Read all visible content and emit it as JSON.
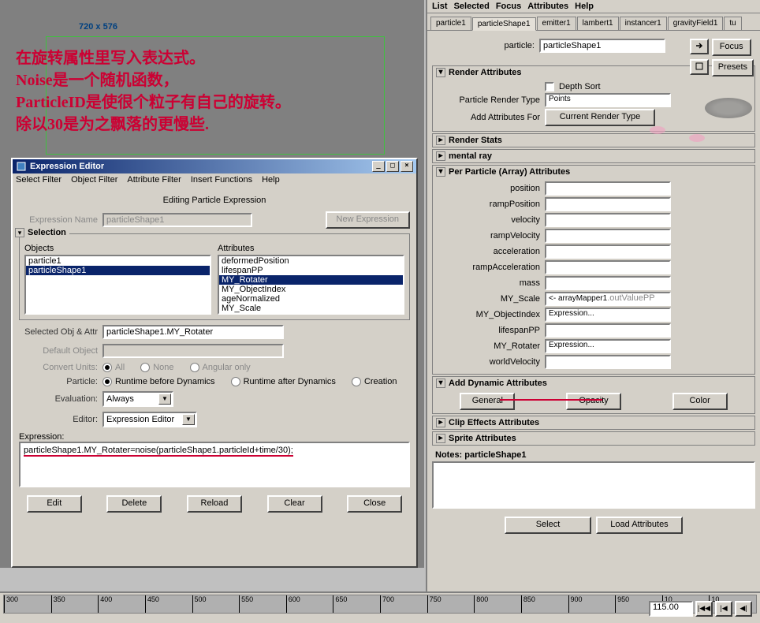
{
  "viewport": {
    "resolution": "720 x 576",
    "annotation": "在旋转属性里写入表达式。\nNoise是一个随机函数，\nParticleID是使很个粒子有自己的旋转。\n除以30是为之飘落的更慢些."
  },
  "expr_editor": {
    "title": "Expression Editor",
    "menu": [
      "Select Filter",
      "Object Filter",
      "Attribute Filter",
      "Insert Functions",
      "Help"
    ],
    "subtitle": "Editing Particle Expression",
    "expr_name_label": "Expression Name",
    "expr_name_value": "particleShape1",
    "new_expr_btn": "New Expression",
    "selection_legend": "Selection",
    "objects_label": "Objects",
    "attributes_label": "Attributes",
    "objects": [
      "particle1",
      "particleShape1"
    ],
    "attributes": [
      "deformedPosition",
      "lifespanPP",
      "MY_Rotater",
      "MY_ObjectIndex",
      "ageNormalized",
      "MY_Scale"
    ],
    "selected_obj_label": "Selected Obj & Attr",
    "selected_obj_value": "particleShape1.MY_Rotater",
    "default_obj_label": "Default Object",
    "convert_units_label": "Convert Units:",
    "convert_units_options": [
      "All",
      "None",
      "Angular only"
    ],
    "particle_label": "Particle:",
    "particle_options": [
      "Runtime before Dynamics",
      "Runtime after Dynamics",
      "Creation"
    ],
    "evaluation_label": "Evaluation:",
    "evaluation_value": "Always",
    "editor_label": "Editor:",
    "editor_value": "Expression Editor",
    "expression_label": "Expression:",
    "expression_text": "particleShape1.MY_Rotater=noise(particleShape1.particleId+time/30);",
    "buttons": [
      "Edit",
      "Delete",
      "Reload",
      "Clear",
      "Close"
    ]
  },
  "attr_editor": {
    "menu": [
      "List",
      "Selected",
      "Focus",
      "Attributes",
      "Help"
    ],
    "tabs": [
      "particle1",
      "particleShape1",
      "emitter1",
      "lambert1",
      "instancer1",
      "gravityField1",
      "tu"
    ],
    "active_tab": "particleShape1",
    "particle_label": "particle:",
    "particle_value": "particleShape1",
    "focus_btn": "Focus",
    "presets_btn": "Presets",
    "sections": {
      "render_attrs": {
        "title": "Render Attributes",
        "depth_sort_label": "Depth Sort",
        "render_type_label": "Particle Render Type",
        "render_type_value": "Points",
        "add_attrs_label": "Add Attributes For",
        "add_attrs_btn": "Current Render Type"
      },
      "render_stats": "Render Stats",
      "mental_ray": "mental ray",
      "per_particle": {
        "title": "Per Particle (Array) Attributes",
        "attrs": [
          {
            "label": "position",
            "value": ""
          },
          {
            "label": "rampPosition",
            "value": ""
          },
          {
            "label": "velocity",
            "value": ""
          },
          {
            "label": "rampVelocity",
            "value": ""
          },
          {
            "label": "acceleration",
            "value": ""
          },
          {
            "label": "rampAcceleration",
            "value": ""
          },
          {
            "label": "mass",
            "value": ""
          },
          {
            "label": "MY_Scale",
            "value": "<- arrayMapper1.outValuePP"
          },
          {
            "label": "MY_ObjectIndex",
            "value": "Expression..."
          },
          {
            "label": "lifespanPP",
            "value": ""
          },
          {
            "label": "MY_Rotater",
            "value": "Expression..."
          },
          {
            "label": "worldVelocity",
            "value": ""
          }
        ]
      },
      "add_dynamic": {
        "title": "Add Dynamic Attributes",
        "buttons": [
          "General",
          "Opacity",
          "Color"
        ]
      },
      "clip_effects": "Clip Effects Attributes",
      "sprite_attrs": "Sprite Attributes"
    },
    "notes_label": "Notes: particleShape1",
    "bottom_buttons": [
      "Select",
      "Load Attributes"
    ]
  },
  "timeline": {
    "ticks": [
      "300",
      "350",
      "400",
      "450",
      "500",
      "550",
      "600",
      "650",
      "700",
      "750",
      "800",
      "850",
      "900",
      "950",
      "10",
      "10"
    ],
    "current_frame": "115.00"
  }
}
